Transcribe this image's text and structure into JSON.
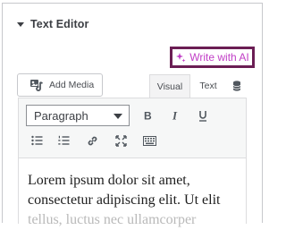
{
  "panel": {
    "title": "Text Editor"
  },
  "ai": {
    "label": "Write with AI",
    "accent": "#c13ec6",
    "highlight": "#6b1e54"
  },
  "media": {
    "label": "Add Media"
  },
  "tabs": {
    "visual": "Visual",
    "text": "Text"
  },
  "toolbar": {
    "format_value": "Paragraph",
    "buttons": [
      "bold-icon",
      "italic-icon",
      "underline-icon",
      "bullet-list-icon",
      "numbered-list-icon",
      "link-icon",
      "fullscreen-icon",
      "keyboard-icon"
    ]
  },
  "content": {
    "line1": "Lorem ipsum dolor sit amet,",
    "line2": "consectetur adipiscing elit. Ut elit",
    "line3": "tellus, luctus nec ullamcorper"
  }
}
